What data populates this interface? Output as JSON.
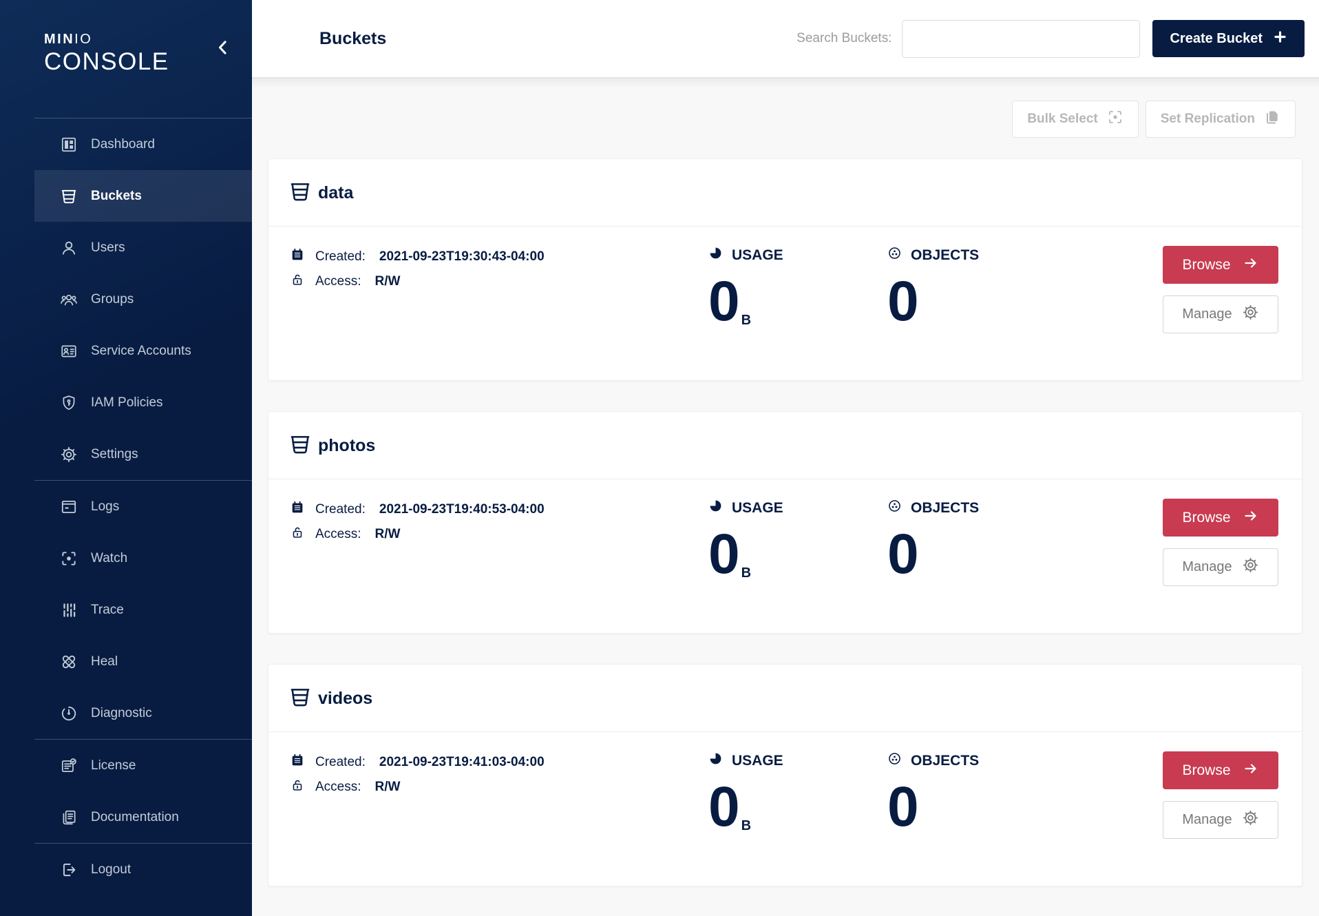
{
  "brand": {
    "bold": "MIN",
    "light": "IO",
    "line2": "CONSOLE"
  },
  "sidebar": {
    "items": [
      {
        "label": "Dashboard"
      },
      {
        "label": "Buckets"
      },
      {
        "label": "Users"
      },
      {
        "label": "Groups"
      },
      {
        "label": "Service Accounts"
      },
      {
        "label": "IAM Policies"
      },
      {
        "label": "Settings"
      },
      {
        "label": "Logs"
      },
      {
        "label": "Watch"
      },
      {
        "label": "Trace"
      },
      {
        "label": "Heal"
      },
      {
        "label": "Diagnostic"
      },
      {
        "label": "License"
      },
      {
        "label": "Documentation"
      },
      {
        "label": "Logout"
      }
    ]
  },
  "header": {
    "title": "Buckets",
    "search_label": "Search Buckets:",
    "search_value": "",
    "create_button_label": "Create Bucket"
  },
  "toolbar": {
    "bulk_select_label": "Bulk Select",
    "set_replication_label": "Set Replication"
  },
  "bucket_list": {
    "created_label": "Created:",
    "access_label": "Access:",
    "usage_label": "USAGE",
    "objects_label": "OBJECTS",
    "browse_label": "Browse",
    "manage_label": "Manage",
    "buckets": [
      {
        "name": "data",
        "created": "2021-09-23T19:30:43-04:00",
        "access": "R/W",
        "usage_value": "0",
        "usage_unit": "B",
        "objects_value": "0"
      },
      {
        "name": "photos",
        "created": "2021-09-23T19:40:53-04:00",
        "access": "R/W",
        "usage_value": "0",
        "usage_unit": "B",
        "objects_value": "0"
      },
      {
        "name": "videos",
        "created": "2021-09-23T19:41:03-04:00",
        "access": "R/W",
        "usage_value": "0",
        "usage_unit": "B",
        "objects_value": "0"
      }
    ]
  },
  "colors": {
    "sidebar_navy": "#081C42",
    "accent_red": "#C83B51",
    "text_navy": "#081C42",
    "muted_gray": "#B7B7B7"
  }
}
